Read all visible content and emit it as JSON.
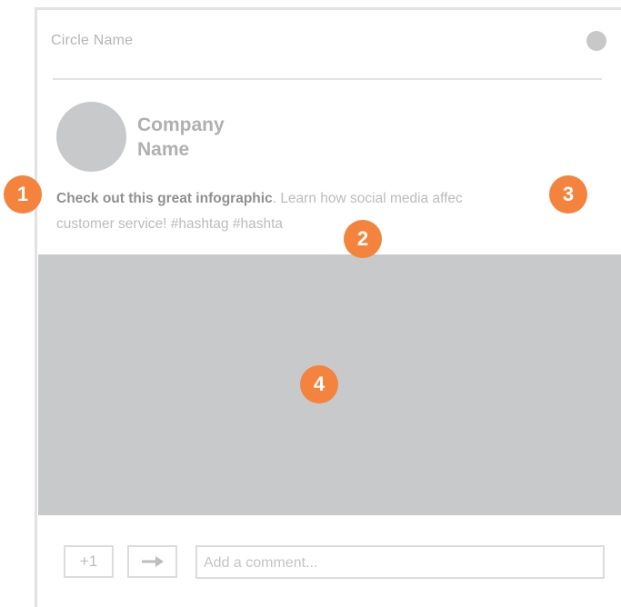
{
  "header": {
    "circle_name": "Circle Name"
  },
  "post": {
    "company_name_line1": "Company",
    "company_name_line2": "Name",
    "text_bold": "Check out this great infographic",
    "text_rest_line1": ". Learn how social media affec",
    "text_line2": "customer service! #hashtag #hashta"
  },
  "annotations": {
    "badge1": "1",
    "badge2": "2",
    "badge3": "3",
    "badge4": "4"
  },
  "actions": {
    "plus_one_label": "+1",
    "share_icon": "arrow-right-icon",
    "comment_placeholder": "Add a comment..."
  },
  "colors": {
    "badge": "#f4833d",
    "placeholder_gray": "#c8c9ca"
  }
}
